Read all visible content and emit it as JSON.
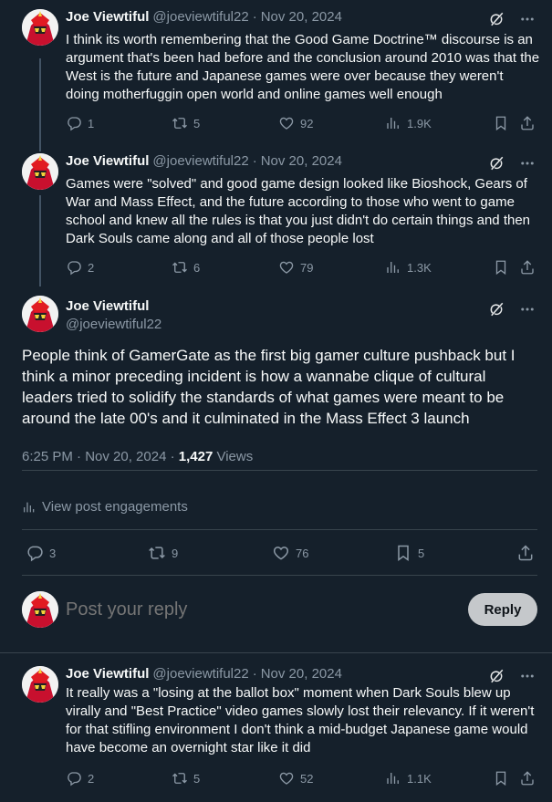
{
  "colors": {
    "background": "#15202b",
    "text": "#f7f9f9",
    "muted": "#8b98a5",
    "divider": "#38444d",
    "reply_button": "#c5c8cb"
  },
  "posts": [
    {
      "name": "Joe Viewtiful",
      "handle": "@joeviewtiful22",
      "sep": "·",
      "date": "Nov 20, 2024",
      "text": "I think its worth remembering that the Good Game Doctrine™ discourse is an argument that's been had before and the conclusion around 2010 was that the West is the future and Japanese games were over because they weren't doing motherfuggin open world and online games well enough",
      "replies": "1",
      "reposts": "5",
      "likes": "92",
      "views": "1.9K"
    },
    {
      "name": "Joe Viewtiful",
      "handle": "@joeviewtiful22",
      "sep": "·",
      "date": "Nov 20, 2024",
      "text": "Games were \"solved\" and good game design looked like Bioshock, Gears of War and Mass Effect, and the future according to those who went to game school and knew all the rules is that you just didn't do certain things and then Dark Souls came along and all of those people lost",
      "replies": "2",
      "reposts": "6",
      "likes": "79",
      "views": "1.3K"
    }
  ],
  "main_post": {
    "name": "Joe Viewtiful",
    "handle": "@joeviewtiful22",
    "text": "People think of GamerGate as the first big gamer culture pushback but I think a minor preceding incident is how a wannabe clique of cultural leaders tried to solidify the standards of what games were meant to be around the late 00's and it culminated in the Mass Effect 3 launch",
    "time": "6:25 PM · Nov 20, 2024 · ",
    "views_count": "1,427",
    "views_label": " Views",
    "engagements_label": "View post engagements",
    "replies": "3",
    "reposts": "9",
    "likes": "76",
    "bookmarks": "5"
  },
  "compose": {
    "placeholder": "Post your reply",
    "button": "Reply"
  },
  "reply_post": {
    "name": "Joe Viewtiful",
    "handle": "@joeviewtiful22",
    "sep": "·",
    "date": "Nov 20, 2024",
    "text": "It really was a \"losing at the ballot box\" moment when Dark Souls blew up virally and \"Best Practice\" video games slowly lost their relevancy. If it weren't for that stifling environment I don't think a mid-budget Japanese game would have become an overnight star like it did",
    "replies": "2",
    "reposts": "5",
    "likes": "52",
    "views": "1.1K"
  },
  "icons": {
    "grok": "grok-icon",
    "more": "more-icon",
    "reply": "reply-icon",
    "repost": "repost-icon",
    "like": "like-icon",
    "views": "views-icon",
    "bookmark": "bookmark-icon",
    "share": "share-icon"
  }
}
